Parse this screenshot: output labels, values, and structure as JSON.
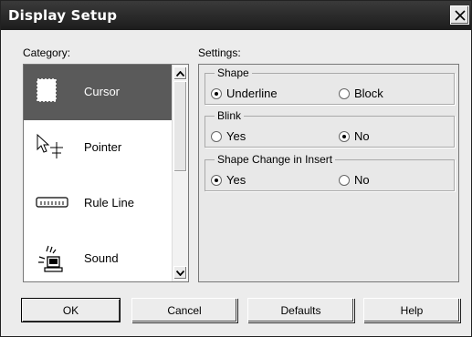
{
  "window": {
    "title": "Display Setup"
  },
  "category": {
    "label": "Category:",
    "items": [
      {
        "label": "Cursor",
        "icon": "cursor-icon",
        "selected": true
      },
      {
        "label": "Pointer",
        "icon": "pointer-icon",
        "selected": false
      },
      {
        "label": "Rule Line",
        "icon": "rule-line-icon",
        "selected": false
      },
      {
        "label": "Sound",
        "icon": "sound-icon",
        "selected": false
      }
    ]
  },
  "settings": {
    "label": "Settings:",
    "groups": [
      {
        "title": "Shape",
        "options": [
          {
            "label": "Underline",
            "checked": true
          },
          {
            "label": "Block",
            "checked": false
          }
        ]
      },
      {
        "title": "Blink",
        "options": [
          {
            "label": "Yes",
            "checked": false
          },
          {
            "label": "No",
            "checked": true
          }
        ]
      },
      {
        "title": "Shape Change in Insert",
        "options": [
          {
            "label": "Yes",
            "checked": true
          },
          {
            "label": "No",
            "checked": false
          }
        ]
      }
    ]
  },
  "buttons": {
    "ok": "OK",
    "cancel": "Cancel",
    "defaults": "Defaults",
    "help": "Help"
  },
  "colors": {
    "titlebar": "#2a2a2a",
    "selection": "#5a5a5a",
    "face": "#ececec"
  }
}
